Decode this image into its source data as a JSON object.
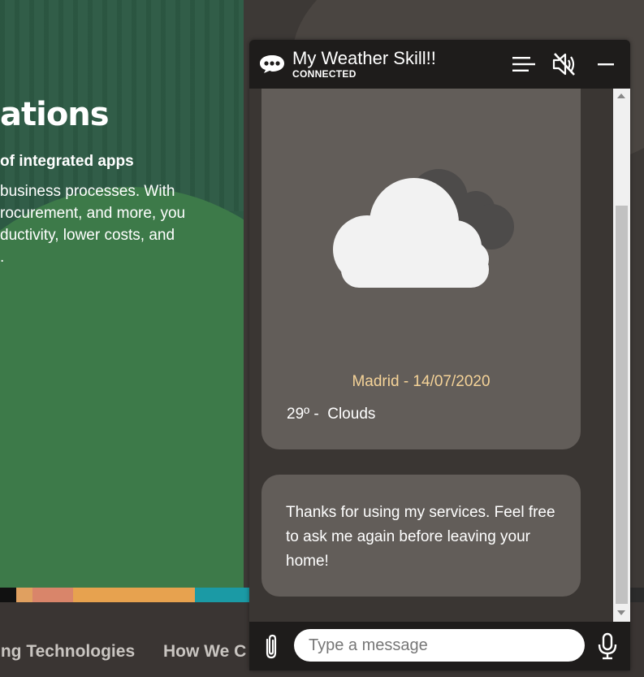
{
  "page": {
    "hero_title": "ations",
    "hero_subtitle": "of integrated apps",
    "hero_body_lines": [
      "business processes. With",
      "rocurement, and more, you",
      "ductivity, lower costs, and",
      "."
    ],
    "footer_links": [
      "ing Technologies",
      "How We C"
    ]
  },
  "chat": {
    "title": "My Weather Skill!!",
    "status": "CONNECTED",
    "icons": {
      "bot": "chat-bubble-icon",
      "menu": "menu-icon",
      "mute": "speaker-muted-icon",
      "minimize": "minimize-icon",
      "attach": "paperclip-icon",
      "mic": "microphone-icon",
      "weather": "cloud-icon"
    },
    "card": {
      "location_date": "Madrid - 14/07/2020",
      "weather": "29º -  Clouds"
    },
    "bubble": "Thanks for using my services. Feel free to ask me again before leaving your home!",
    "input_placeholder": "Type a message"
  },
  "colors": {
    "header": "#1e1c1b",
    "card": "#625d59",
    "accent_text": "#f5d398"
  }
}
